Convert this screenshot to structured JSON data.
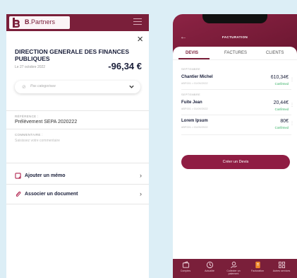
{
  "colors": {
    "brand": "#7a1f3a",
    "accent_button": "#8f1d43",
    "confirmed": "#2fae5f",
    "background": "#dceef6"
  },
  "left": {
    "logo": {
      "text_initial": "B",
      "text_rest": ".Partners"
    },
    "transaction": {
      "title": "DIRECTION GENERALE DES FINANCES PUBLIQUES",
      "date": "Le 27 octobre 2022",
      "amount": "-96,34 €"
    },
    "category_select": {
      "placeholder": "Pas categorisee"
    },
    "reference": {
      "label": "RÉFÉRENCE :",
      "value": "Prélèvement SEPA 2020222"
    },
    "comment": {
      "label": "COMMENTAIRE :",
      "placeholder": "Saisissez votre commentaire"
    },
    "actions": [
      {
        "label": "Ajouter un mémo",
        "icon": "memo-icon"
      },
      {
        "label": "Associer un document",
        "icon": "paperclip-icon"
      }
    ]
  },
  "right": {
    "title": "FACTURATION",
    "tabs": [
      {
        "label": "DEVIS",
        "active": true
      },
      {
        "label": "FACTURES",
        "active": false
      },
      {
        "label": "CLIENTS",
        "active": false
      }
    ],
    "groups": [
      {
        "month": "SEPTEMBRE",
        "items": [
          {
            "name": "Chantier Michel",
            "meta": "#BF001  •  01/09/2022",
            "amount": "610,34€",
            "status": "Confirmed"
          }
        ]
      },
      {
        "month": "SEPTEMBRE",
        "items": [
          {
            "name": "Fuite Jean",
            "meta": "#BF001  •  01/09/2022",
            "amount": "20,44€",
            "status": "Confirmed"
          },
          {
            "name": "Lorem Ipsum",
            "meta": "#BF001  •  01/09/2022",
            "amount": "80€",
            "status": "Confirmed"
          }
        ]
      }
    ],
    "cta": "Créer un Devis",
    "nav": [
      {
        "label": "Comptes",
        "icon": "wallet-icon"
      },
      {
        "label": "Actualité",
        "icon": "news-icon"
      },
      {
        "label": "Collecter un paiement",
        "icon": "collect-payment-icon"
      },
      {
        "label": "Facturation",
        "icon": "invoice-icon"
      },
      {
        "label": "Autres services",
        "icon": "grid-icon"
      }
    ]
  }
}
